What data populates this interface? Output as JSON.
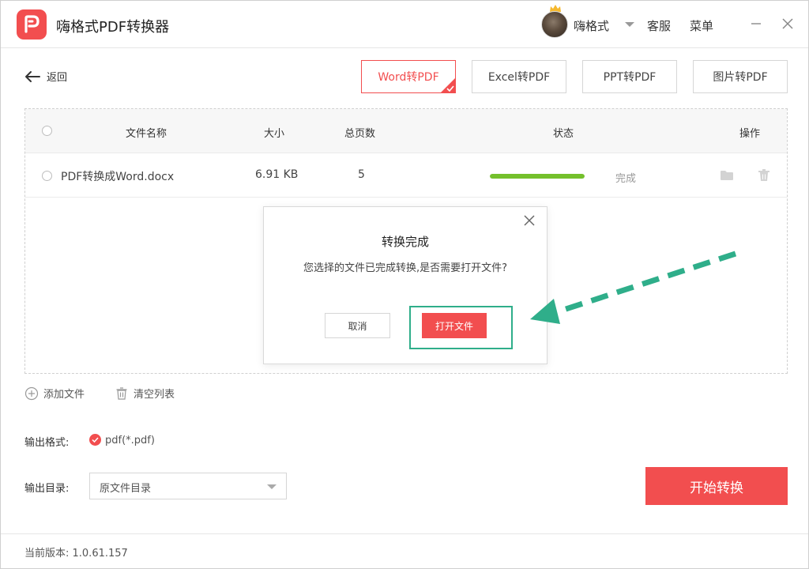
{
  "app": {
    "title": "嗨格式PDF转换器",
    "username": "嗨格式",
    "service_label": "客服",
    "menu_label": "菜单",
    "brand_color": "#f24e4f"
  },
  "nav": {
    "back_label": "返回"
  },
  "tabs": [
    {
      "label": "Word转PDF",
      "active": true
    },
    {
      "label": "Excel转PDF",
      "active": false
    },
    {
      "label": "PPT转PDF",
      "active": false
    },
    {
      "label": "图片转PDF",
      "active": false
    }
  ],
  "table": {
    "headers": {
      "name": "文件名称",
      "size": "大小",
      "pages": "总页数",
      "status": "状态",
      "actions": "操作"
    },
    "rows": [
      {
        "name": "PDF转换成Word.docx",
        "size": "6.91 KB",
        "pages": "5",
        "status": "完成",
        "progress": 1.0
      }
    ],
    "progress_color": "#74c02c"
  },
  "dialog": {
    "title": "转换完成",
    "message": "您选择的文件已完成转换,是否需要打开文件?",
    "cancel_label": "取消",
    "open_label": "打开文件",
    "highlight_color": "#2fae8a"
  },
  "list_actions": {
    "add_label": "添加文件",
    "clear_label": "清空列表"
  },
  "output": {
    "format_label": "输出格式:",
    "format_value": "pdf(*.pdf)",
    "dir_label": "输出目录:",
    "dir_value": "原文件目录"
  },
  "start_label": "开始转换",
  "footer": {
    "version_text": "当前版本: 1.0.61.157"
  }
}
